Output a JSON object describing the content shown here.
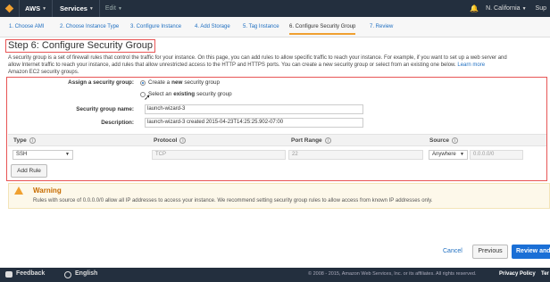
{
  "topbar": {
    "brand": "AWS",
    "services": "Services",
    "edit": "Edit",
    "region": "N. California",
    "support": "Sup"
  },
  "wizard": {
    "steps": [
      "1. Choose AMI",
      "2. Choose Instance Type",
      "3. Configure Instance",
      "4. Add Storage",
      "5. Tag Instance",
      "6. Configure Security Group",
      "7. Review"
    ]
  },
  "main": {
    "title": "Step 6: Configure Security Group",
    "desc_line1": "A security group is a set of firewall rules that control the traffic for your instance. On this page, you can add rules to allow specific traffic to reach your instance. For example, if you want to set up a web server and",
    "desc_line2": "allow Internet traffic to reach your instance, add rules that allow unrestricted access to the HTTP and HTTPS ports. You can create a new security group or select from an existing one below.",
    "desc_link": "Learn more",
    "desc_line3": "Amazon EC2 security groups."
  },
  "form": {
    "assign_label": "Assign a security group:",
    "option_new_prefix": "Create a",
    "option_new_bold": "new",
    "option_new_suffix": "security group",
    "option_existing_prefix": "Select an",
    "option_existing_bold": "existing",
    "option_existing_suffix": "security group",
    "name_label": "Security group name:",
    "name_value": "launch-wizard-3",
    "description_label": "Description:",
    "description_value": "launch-wizard-3 created 2015-04-23T14:25:25.902-07:00"
  },
  "rules": {
    "headers": [
      "Type",
      "Protocol",
      "Port Range",
      "Source"
    ],
    "row": {
      "type": "SSH",
      "protocol": "TCP",
      "port": "22",
      "source_select": "Anywhere",
      "source_cidr": "0.0.0.0/0"
    },
    "add_rule": "Add Rule"
  },
  "warning": {
    "title": "Warning",
    "text": "Rules with source of 0.0.0.0/0 allow all IP addresses to access your instance. We recommend setting security group rules to allow access from known IP addresses only."
  },
  "actions": {
    "cancel": "Cancel",
    "previous": "Previous",
    "review": "Review and"
  },
  "footer": {
    "feedback": "Feedback",
    "language": "English",
    "copyright": "© 2008 - 2015, Amazon Web Services, Inc. or its affiliates. All rights reserved.",
    "privacy": "Privacy Policy",
    "terms": "Ter"
  },
  "colors": {
    "topbar": "#232f3e",
    "accent": "#f0a030",
    "link": "#1f6fc1",
    "highlight_box": "#e85555",
    "primary_button": "#1a6fd6"
  }
}
